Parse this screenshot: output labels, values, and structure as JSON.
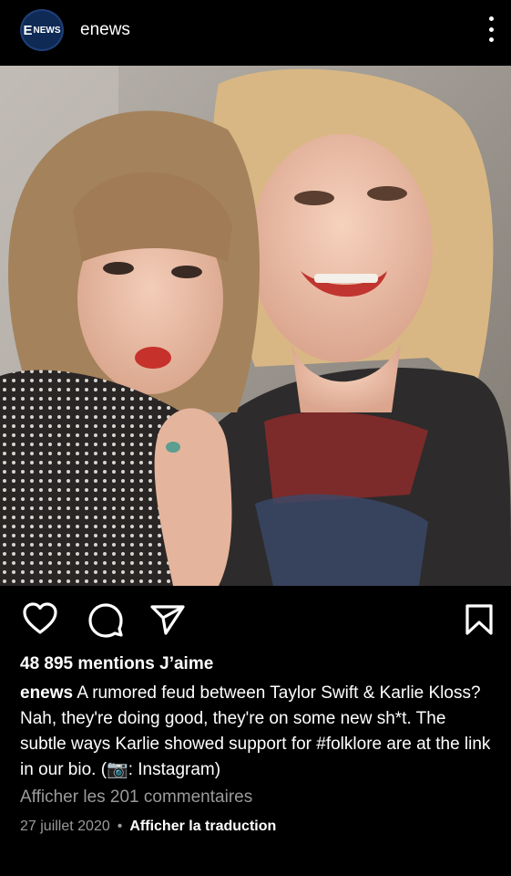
{
  "post": {
    "username": "enews",
    "avatar_text_e": "E",
    "avatar_text_news": "NEWS",
    "likes": "48 895 mentions J’aime",
    "caption_user": "enews",
    "caption_text": "A rumored feud between Taylor Swift & Karlie Kloss? Nah, they're doing good, they're on some new sh*t. The subtle ways Karlie showed support for #folklore are at the link in our bio. (📷: Instagram)",
    "comments_link": "Afficher les 201 commentaires",
    "date": "27 juillet 2020",
    "separator": "•",
    "translate": "Afficher la traduction"
  },
  "icons": {
    "more": "more-vertical-icon",
    "like": "heart-icon",
    "comment": "comment-icon",
    "share": "send-icon",
    "save": "bookmark-icon"
  },
  "colors": {
    "background": "#000000",
    "text": "#ffffff",
    "muted": "#9a9a9a",
    "avatar_bg": "#0e2a55"
  }
}
